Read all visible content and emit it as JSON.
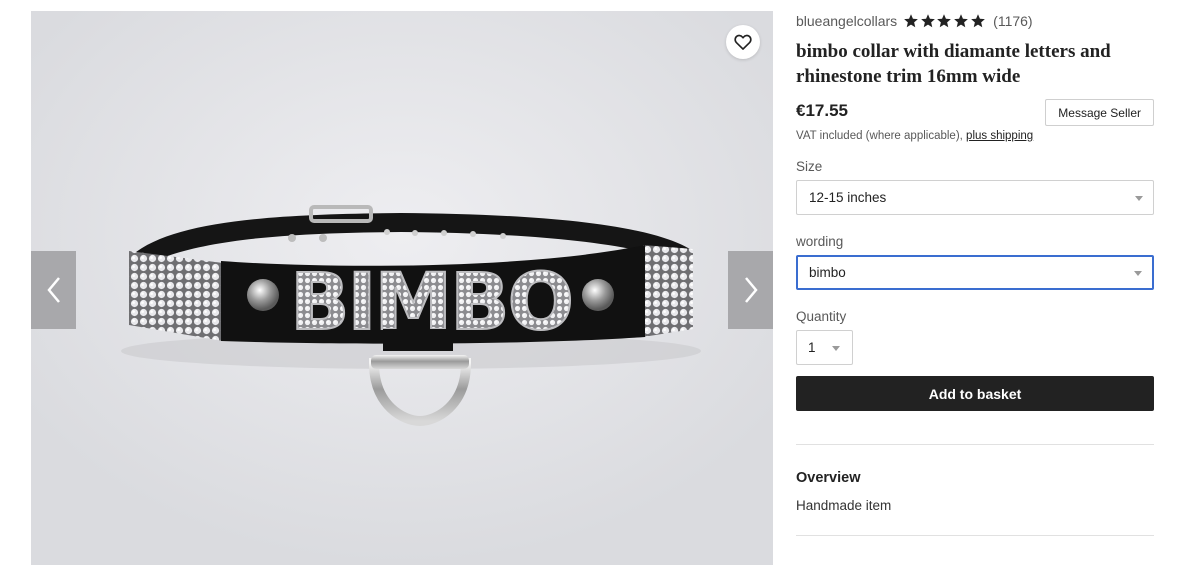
{
  "gallery": {
    "product_image": "bimbo-collar-photo",
    "collar_letters": "BIMBO"
  },
  "shop": {
    "name": "blueangelcollars",
    "rating_stars": 5,
    "review_count": "(1176)"
  },
  "product": {
    "title": "bimbo collar with diamante letters and rhinestone trim 16mm wide",
    "price": "€17.55",
    "message_seller_label": "Message Seller",
    "vat_text": "VAT included (where applicable),",
    "shipping_link": "plus shipping"
  },
  "options": {
    "size_label": "Size",
    "size_value": "12-15 inches",
    "wording_label": "wording",
    "wording_value": "bimbo",
    "quantity_label": "Quantity",
    "quantity_value": "1"
  },
  "actions": {
    "add_to_basket": "Add to basket"
  },
  "overview": {
    "title": "Overview",
    "items": [
      "Handmade item"
    ]
  },
  "colors": {
    "primary_button": "#222222",
    "focus_border": "#3a6dd0",
    "star": "#222222"
  }
}
